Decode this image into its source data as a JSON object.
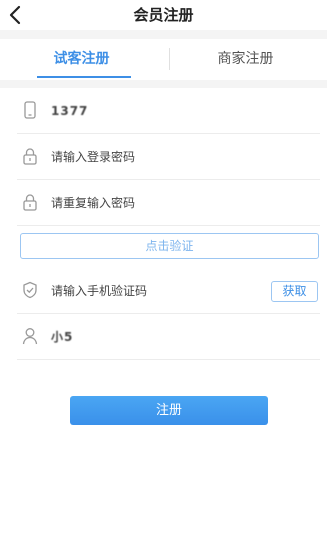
{
  "header": {
    "back_icon": "back-chevron-icon",
    "title": "会员注册"
  },
  "tabs": [
    {
      "label": "试客注册",
      "active": true
    },
    {
      "label": "商家注册",
      "active": false
    }
  ],
  "form": {
    "phone": {
      "icon": "phone-icon",
      "value": "1377"
    },
    "password": {
      "icon": "lock-icon",
      "placeholder": "请输入登录密码"
    },
    "password_confirm": {
      "icon": "lock-icon",
      "placeholder": "请重复输入密码"
    },
    "verify_button": "点击验证",
    "sms_code": {
      "icon": "shield-check-icon",
      "placeholder": "请输入手机验证码",
      "get_button": "获取"
    },
    "username": {
      "icon": "user-icon",
      "value": "小5"
    }
  },
  "submit_button": "注册",
  "colors": {
    "accent": "#3d8fe6",
    "verify_border": "#9cc6f2",
    "background_gap": "#f4f4f4"
  }
}
